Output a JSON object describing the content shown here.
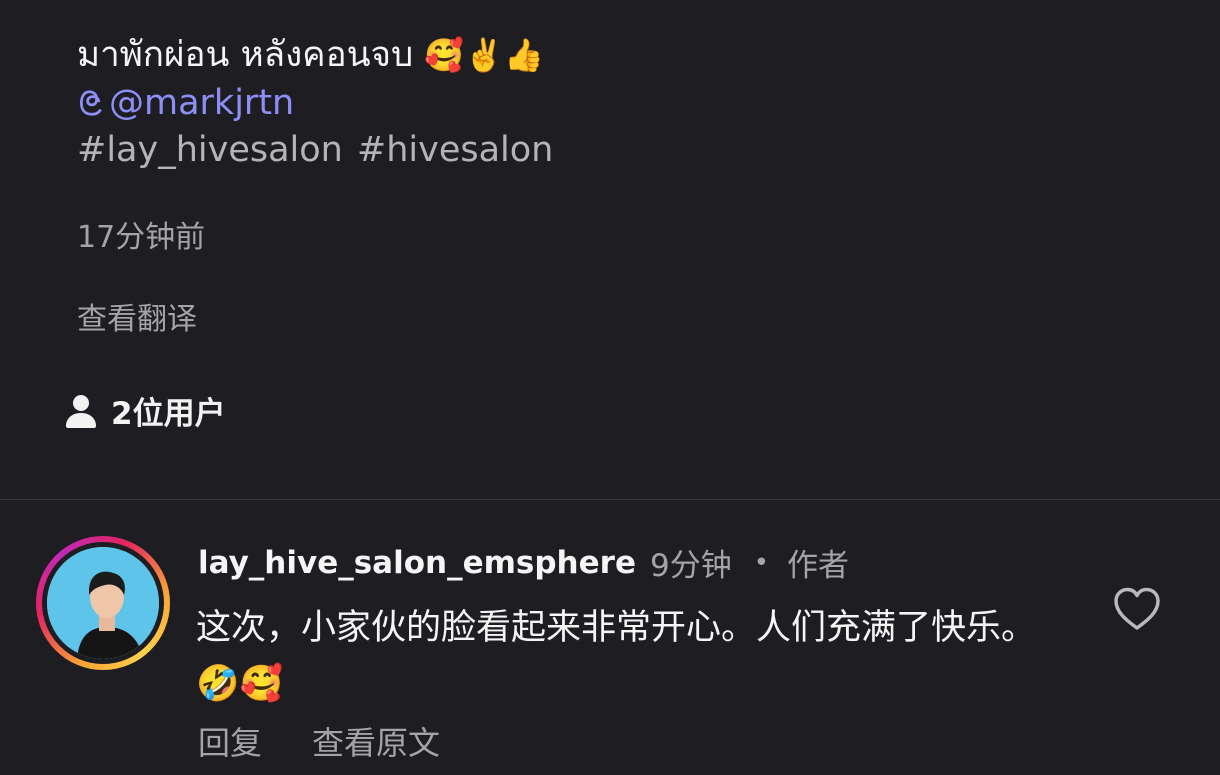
{
  "post": {
    "caption_text": "มาพักผ่อน หลังคอนจบ",
    "caption_emojis": "🥰✌️👍",
    "mention": "@markjrtn",
    "hashtags": [
      "#lay_hivesalon",
      "#hivesalon"
    ],
    "time": "17分钟前",
    "translate_label": "查看翻译",
    "likers_label": "2位用户"
  },
  "comment": {
    "username": "lay_hive_salon_emsphere",
    "time": "9分钟",
    "separator": "•",
    "author_label": "作者",
    "text": "这次，小家伙的脸看起来非常开心。人们充满了快乐。🤣🥰",
    "reply_label": "回复",
    "view_original_label": "查看原文"
  },
  "colors": {
    "background": "#1e1e22",
    "mention": "#8c8ff7",
    "secondary_text": "#a3a3a8"
  },
  "icons": {
    "mention": "threads-icon",
    "likers": "person-icon",
    "like": "heart-icon"
  }
}
